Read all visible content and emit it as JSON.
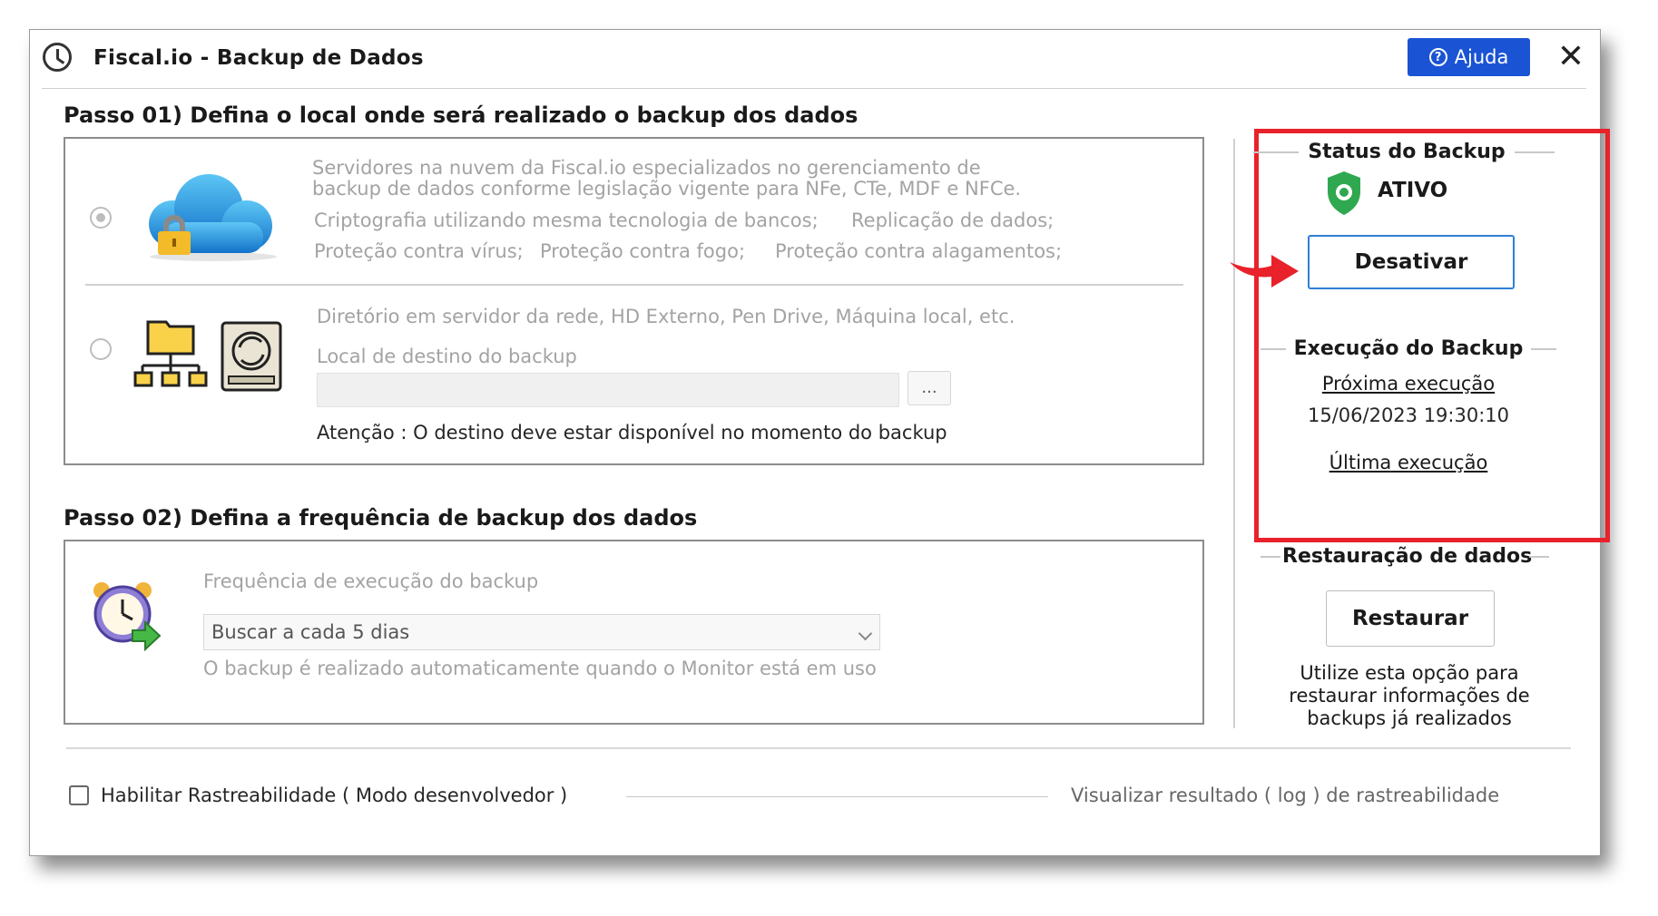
{
  "window": {
    "title": "Fiscal.io - Backup de Dados",
    "help_label": "Ajuda",
    "close_glyph": "✕"
  },
  "step1": {
    "title": "Passo 01)  Defina o local onde será realizado o backup dos dados",
    "cloud": {
      "selected": true,
      "line1": "Servidores na nuvem da Fiscal.io especializados no gerenciamento de",
      "line2": "backup de dados conforme legislação vigente para NFe, CTe, MDF e NFCe.",
      "feature1": "Criptografia utilizando mesma tecnologia de bancos;",
      "feature2": "Replicação de dados;",
      "feature3": "Proteção contra vírus;",
      "feature4": "Proteção contra fogo;",
      "feature5": "Proteção contra alagamentos;"
    },
    "local": {
      "selected": false,
      "description": "Diretório em servidor da rede, HD Externo, Pen Drive, Máquina local, etc.",
      "destination_label": "Local de destino do backup",
      "destination_value": "",
      "browse_label": "...",
      "warning": "Atenção : O destino deve estar disponível no momento do backup"
    }
  },
  "step2": {
    "title": "Passo 02)  Defina a frequência de backup dos dados",
    "frequency_label": "Frequência de execução do backup",
    "frequency_value": "Buscar a cada 5 dias",
    "note": "O backup é realizado automaticamente quando o Monitor está em uso"
  },
  "status": {
    "title": "Status do Backup",
    "state": "ATIVO",
    "deactivate_label": "Desativar",
    "execution_title": "Execução do Backup",
    "next_label": "Próxima execução",
    "next_value": "15/06/2023 19:30:10",
    "last_label": "Última execução"
  },
  "restore": {
    "title": "Restauração de dados",
    "button_label": "Restaurar",
    "desc1": "Utilize esta opção para",
    "desc2": "restaurar informações de",
    "desc3": "backups já realizados"
  },
  "footer": {
    "trace_checkbox_label": "Habilitar Rastreabilidade ( Modo desenvolvedor )",
    "trace_checked": false,
    "view_log_label": "Visualizar resultado ( log ) de rastreabilidade"
  },
  "colors": {
    "accent_blue": "#1a53d4",
    "highlight_red": "#e8212a",
    "shield_green": "#2fa84f",
    "button_border_blue": "#2f7fd6"
  }
}
